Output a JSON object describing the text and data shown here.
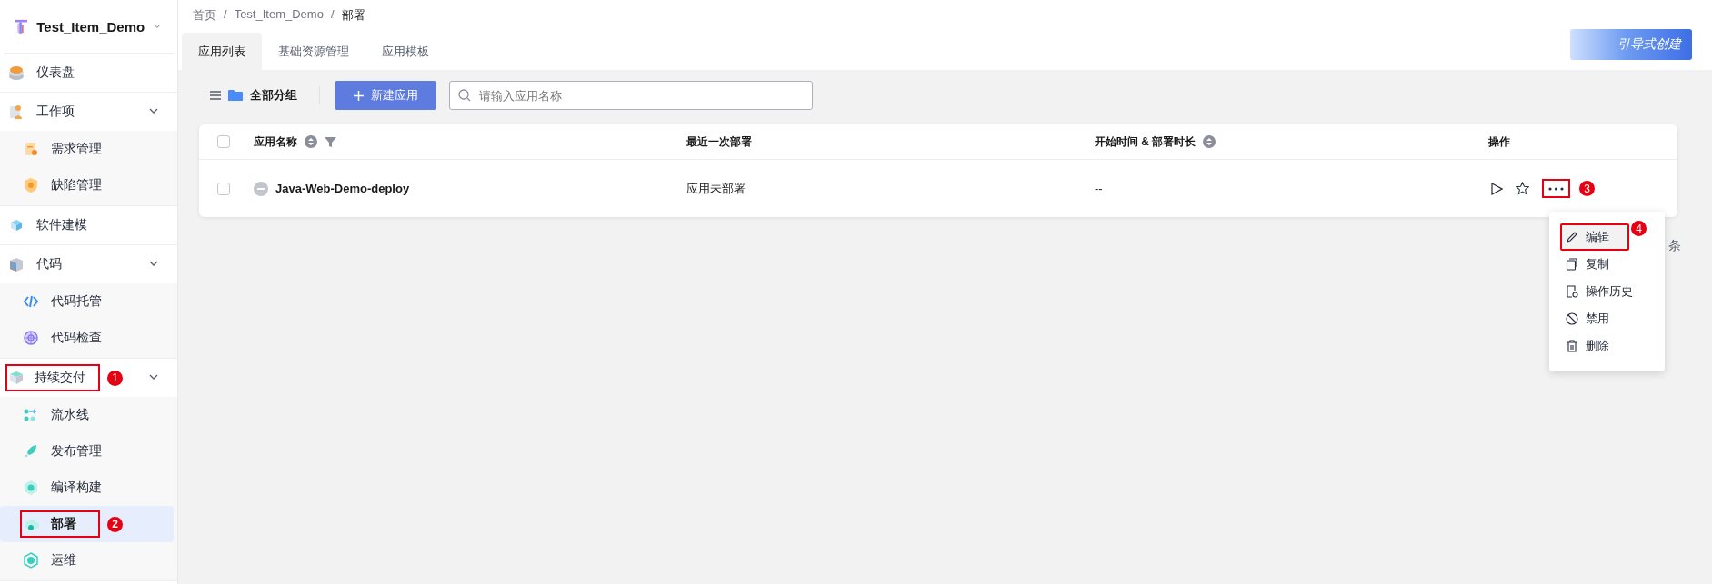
{
  "project": {
    "name": "Test_Item_Demo"
  },
  "sidebar": {
    "items": [
      {
        "label": "仪表盘",
        "selected": false
      },
      {
        "label": "工作项",
        "selected": false,
        "expanded": true,
        "children": [
          {
            "label": "需求管理",
            "selected": false
          },
          {
            "label": "缺陷管理",
            "selected": false
          }
        ]
      },
      {
        "label": "软件建模",
        "selected": false
      },
      {
        "label": "代码",
        "selected": false,
        "expanded": true,
        "children": [
          {
            "label": "代码托管",
            "selected": false
          },
          {
            "label": "代码检查",
            "selected": false
          }
        ]
      },
      {
        "label": "持续交付",
        "selected": false,
        "expanded": true,
        "callout": "1",
        "children": [
          {
            "label": "流水线",
            "selected": false
          },
          {
            "label": "发布管理",
            "selected": false
          },
          {
            "label": "编译构建",
            "selected": false
          },
          {
            "label": "部署",
            "selected": true,
            "callout": "2"
          },
          {
            "label": "运维",
            "selected": false
          }
        ]
      }
    ]
  },
  "breadcrumb": [
    {
      "kind": "link",
      "text": "首页"
    },
    {
      "kind": "separator",
      "text": "/"
    },
    {
      "kind": "link",
      "text": "Test_Item_Demo"
    },
    {
      "kind": "separator",
      "text": "/"
    },
    {
      "kind": "current",
      "text": "部署"
    }
  ],
  "tabs": [
    {
      "label": "应用列表",
      "selected": true
    },
    {
      "label": "基础资源管理",
      "selected": false
    },
    {
      "label": "应用模板",
      "selected": false
    }
  ],
  "guide_button": {
    "label": "引导式创建"
  },
  "toolbar": {
    "group": "全部分组",
    "new_button": "新建应用",
    "search": {
      "placeholder": "请输入应用名称"
    }
  },
  "table": {
    "header_checked": false,
    "columns": [
      {
        "label": "应用名称",
        "sortable": true,
        "filterable": true
      },
      {
        "label": "最近一次部署",
        "sortable": false,
        "filterable": false
      },
      {
        "label": "开始时间 & 部署时长",
        "sortable": true,
        "filterable": false
      },
      {
        "label": "操作",
        "sortable": false,
        "filterable": false
      }
    ],
    "rows": [
      {
        "checked": false,
        "name": "Java-Web-Demo-deploy",
        "last_deploy": "应用未部署",
        "time": "--",
        "more_callout": "3"
      }
    ]
  },
  "pagination_fragment": "条",
  "context_menu": {
    "items": [
      {
        "label": "编辑",
        "selected": true,
        "callout": "4"
      },
      {
        "label": "复制",
        "selected": false
      },
      {
        "label": "操作历史",
        "selected": false
      },
      {
        "label": "禁用",
        "selected": false
      },
      {
        "label": "删除",
        "selected": false
      }
    ]
  }
}
